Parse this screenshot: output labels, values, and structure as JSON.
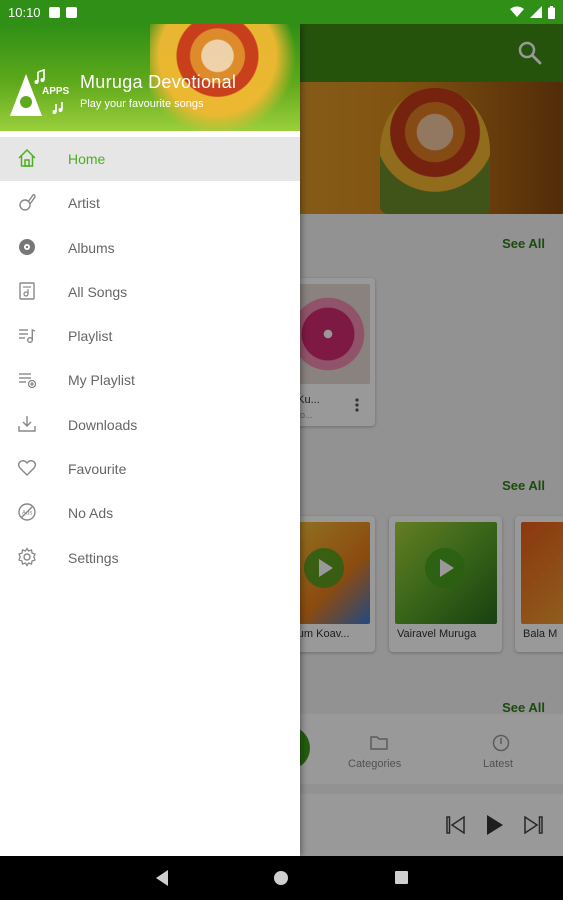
{
  "status_bar": {
    "time": "10:10"
  },
  "drawer": {
    "app_name": "Muruga Devotional",
    "tagline": "Play your favourite songs",
    "logo_text": "APPS",
    "items": [
      {
        "label": "Home",
        "icon": "home-icon",
        "active": true
      },
      {
        "label": "Artist",
        "icon": "artist-icon",
        "active": false
      },
      {
        "label": "Albums",
        "icon": "album-icon",
        "active": false
      },
      {
        "label": "All Songs",
        "icon": "all-songs-icon",
        "active": false
      },
      {
        "label": "Playlist",
        "icon": "playlist-icon",
        "active": false
      },
      {
        "label": "My Playlist",
        "icon": "my-playlist-icon",
        "active": false
      },
      {
        "label": "Downloads",
        "icon": "download-icon",
        "active": false
      },
      {
        "label": "Favourite",
        "icon": "heart-icon",
        "active": false
      },
      {
        "label": "No Ads",
        "icon": "no-ads-icon",
        "active": false
      },
      {
        "label": "Settings",
        "icon": "gear-icon",
        "active": false
      }
    ]
  },
  "background": {
    "see_all_label": "See All",
    "album_card_title": "a Ku...",
    "album_card_subtitle": "...vo...",
    "song_cards": [
      "arum Koav...",
      "Vairavel Muruga",
      "Bala M"
    ],
    "nav": {
      "categories": "Categories",
      "latest": "Latest"
    }
  },
  "colors": {
    "primary": "#3f8a14",
    "accent": "#4caf20",
    "drawer_bg": "#ffffff"
  }
}
